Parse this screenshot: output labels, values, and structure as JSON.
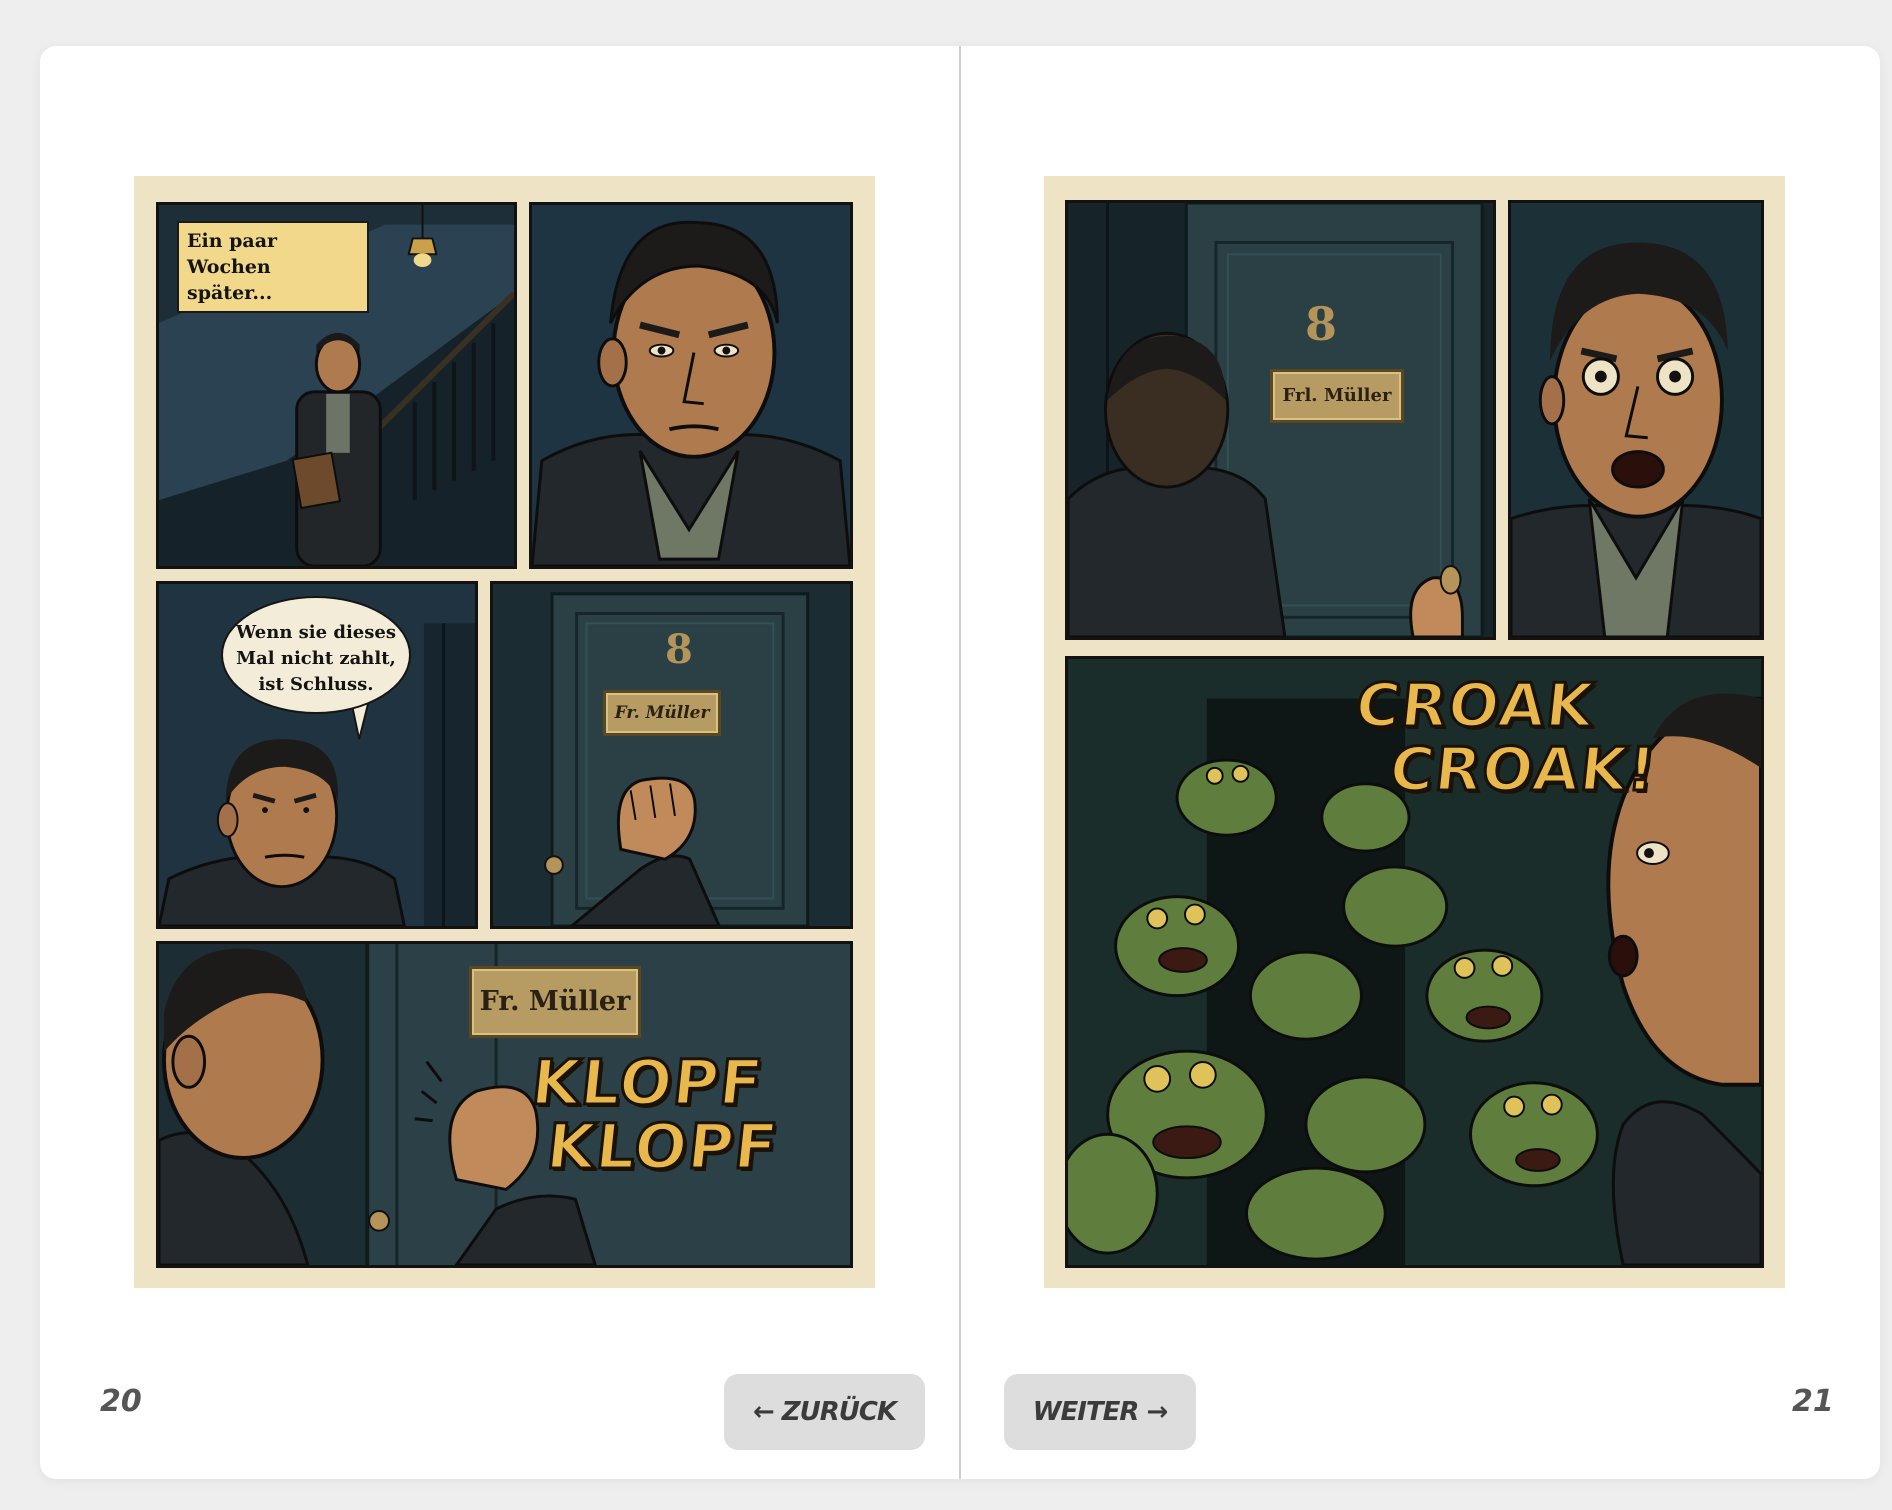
{
  "comic": {
    "left_page": {
      "number": "20",
      "panel1": {
        "caption_line1": "Ein paar Wochen",
        "caption_line2": "später..."
      },
      "panel3": {
        "bubble_line1": "Wenn sie dieses",
        "bubble_line2": "Mal nicht zahlt,",
        "bubble_line3": "ist Schluss."
      },
      "panel4": {
        "door_number": "8",
        "nameplate": "Fr. Müller"
      },
      "panel5": {
        "nameplate": "Fr. Müller",
        "sfx_line1": "KLOPF",
        "sfx_line2": "KLOPF"
      }
    },
    "right_page": {
      "number": "21",
      "panel1": {
        "door_number": "8",
        "nameplate": "Frl. Müller"
      },
      "panel3": {
        "sfx_line1": "CROAK",
        "sfx_line2": "CROAK!"
      }
    }
  },
  "nav": {
    "back_label": "← ZURÜCK",
    "next_label": "WEITER →"
  },
  "colors": {
    "page_background": "#ffffff",
    "paper": "#efe3c6",
    "sfx_yellow": "#e9b84c",
    "button_gray": "#dddddd"
  }
}
